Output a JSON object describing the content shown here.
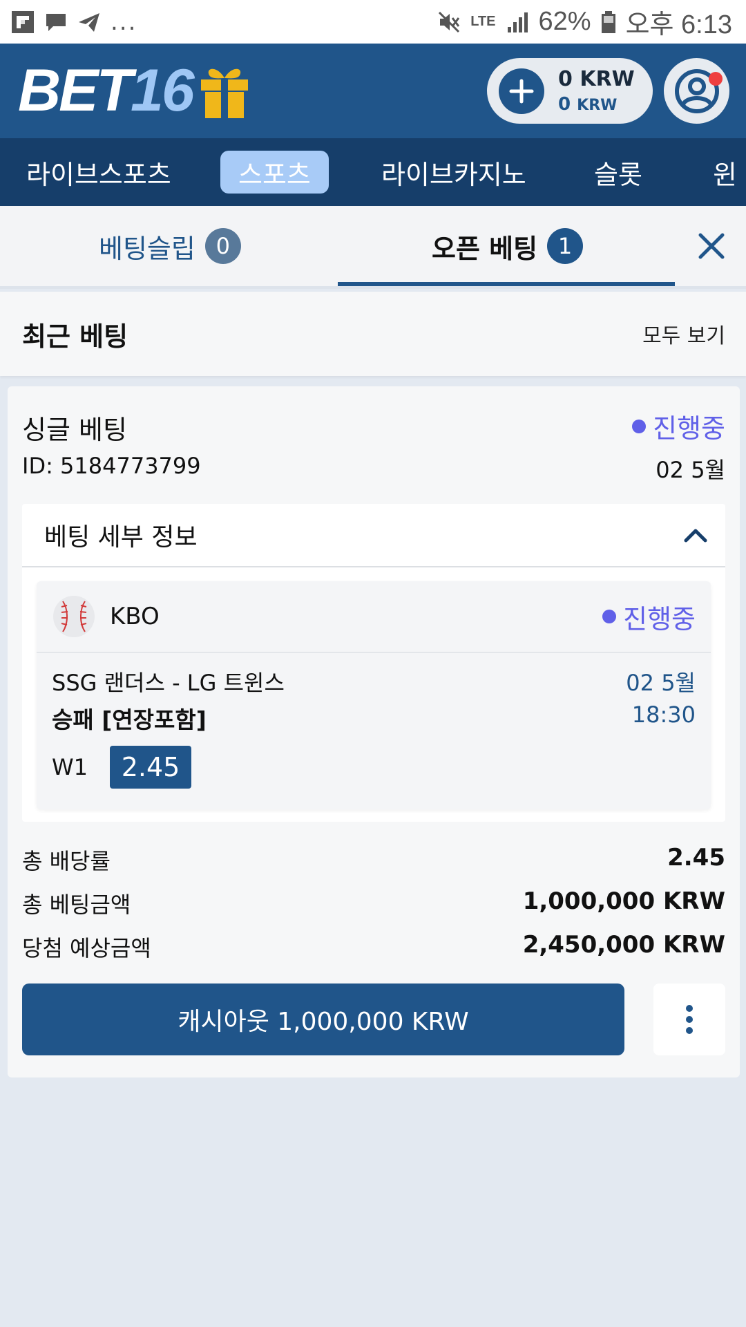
{
  "status_bar": {
    "dots": "...",
    "network": "LTE",
    "battery": "62%",
    "time": "오후 6:13"
  },
  "header": {
    "logo_main": "BET",
    "logo_accent": "16",
    "balance_main": "0 KRW",
    "balance_bonus_value": "0",
    "balance_bonus_unit": "KRW"
  },
  "nav": {
    "items": [
      {
        "label": "라이브스포츠"
      },
      {
        "label": "스포츠"
      },
      {
        "label": "라이브카지노"
      },
      {
        "label": "슬롯"
      },
      {
        "label": "윈"
      }
    ]
  },
  "tabs": {
    "betslip_label": "베팅슬립",
    "betslip_count": "0",
    "open_label": "오픈 베팅",
    "open_count": "1"
  },
  "recent": {
    "title": "최근 베팅",
    "see_all": "모두 보기"
  },
  "bet": {
    "type": "싱글 베팅",
    "status": "진행중",
    "id": "ID: 5184773799",
    "date": "02 5월",
    "details_title": "베팅 세부 정보",
    "event": {
      "league": "KBO",
      "status": "진행중",
      "match": "SSG 랜더스 - LG 트윈스",
      "market": "승패 [연장포함]",
      "date": "02 5월",
      "time": "18:30",
      "pick": "W1",
      "odds": "2.45"
    },
    "summary": [
      {
        "label": "총 배당률",
        "value": "2.45"
      },
      {
        "label": "총 베팅금액",
        "value": "1,000,000 KRW"
      },
      {
        "label": "당첨 예상금액",
        "value": "2,450,000 KRW"
      }
    ],
    "cashout_label": "캐시아웃 1,000,000 KRW"
  },
  "colors": {
    "primary": "#20558a",
    "nav_bg": "#163e6a",
    "nav_active": "#a8cbf7",
    "live_status": "#6060e8",
    "notification": "#ef3f3f",
    "gift": "#f0b71a"
  }
}
